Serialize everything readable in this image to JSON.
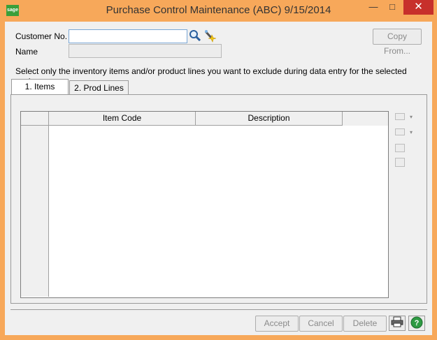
{
  "window": {
    "title": "Purchase Control Maintenance (ABC) 9/15/2014",
    "app_icon_text": "sage",
    "min_glyph": "—",
    "max_glyph": "□",
    "close_glyph": "✕"
  },
  "form": {
    "customer_label": "Customer No.",
    "customer_value": "",
    "name_label": "Name",
    "copy_from_label": "Copy From...",
    "instructions": "Select only the inventory items and/or product lines you want to exclude during data entry for the selected customer."
  },
  "tabs": [
    {
      "label": "1. Items",
      "active": true
    },
    {
      "label": "2. Prod Lines",
      "active": false
    }
  ],
  "grid": {
    "columns": [
      "Item Code",
      "Description"
    ]
  },
  "footer": {
    "accept": "Accept",
    "cancel": "Cancel",
    "delete": "Delete"
  },
  "icons": {
    "lookup": "magnifier-icon",
    "wizard": "wand-icon",
    "print": "printer-icon",
    "help": "help-icon"
  },
  "colors": {
    "title_bar": "#f7a85a",
    "close_button": "#c7302b",
    "help_green": "#2e9a43"
  }
}
